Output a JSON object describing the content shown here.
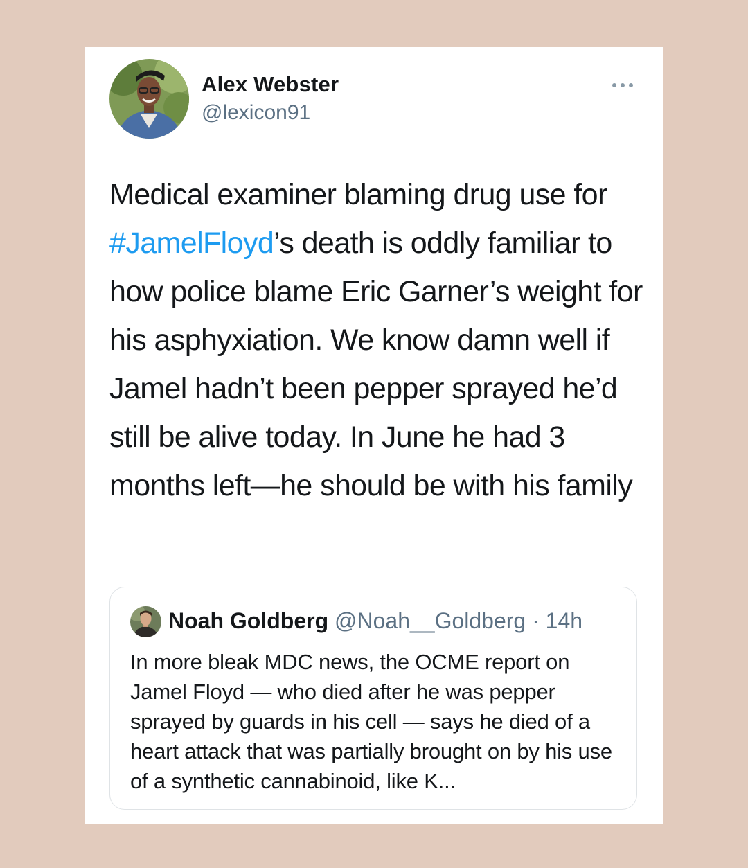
{
  "tweet": {
    "display_name": "Alex Webster",
    "handle": "@lexicon91",
    "more_icon": "more-horizontal-icon",
    "text_before_hashtag": "Medical examiner blaming drug use for ",
    "hashtag": "#JamelFloyd",
    "text_after_hashtag": "’s death is oddly familiar to how police blame Eric Garner’s weight for his asphyxiation. We know damn well if Jamel hadn’t been pepper sprayed he’d still be alive today. In June he had 3 months left—he should be with his family",
    "hashtag_color": "#1d9bf0"
  },
  "quoted_tweet": {
    "display_name": "Noah Goldberg",
    "handle": "@Noah__Goldberg",
    "separator": " · ",
    "time": "14h",
    "text": "In more bleak MDC news, the OCME report on Jamel Floyd — who died after he was pepper sprayed by guards in his cell — says he died of a heart attack that was partially brought on by his use of a synthetic cannabinoid, like K..."
  },
  "colors": {
    "background": "#e2cbbd",
    "card": "#ffffff",
    "text": "#14171a",
    "secondary_text": "#5b7083"
  }
}
